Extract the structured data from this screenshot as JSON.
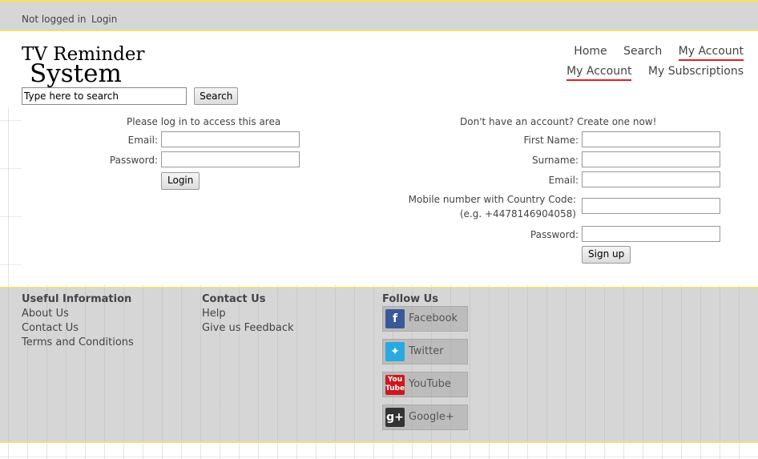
{
  "topbar": {
    "status": "Not logged in",
    "login_link": "Login"
  },
  "logo": {
    "line1": "TV Reminder",
    "line2": "System"
  },
  "search": {
    "placeholder": "Type here to search",
    "button": "Search"
  },
  "nav": {
    "primary": [
      "Home",
      "Search",
      "My Account"
    ],
    "secondary": [
      "My Account",
      "My Subscriptions"
    ]
  },
  "login": {
    "heading": "Please log in to access this area",
    "email_label": "Email:",
    "password_label": "Password:",
    "button": "Login"
  },
  "signup": {
    "heading": "Don't have an account? Create one now!",
    "first_name_label": "First Name:",
    "surname_label": "Surname:",
    "email_label": "Email:",
    "mobile_label_line1": "Mobile number with Country Code:",
    "mobile_label_line2": "(e.g. +4478146904058)",
    "password_label": "Password:",
    "button": "Sign up"
  },
  "footer": {
    "useful": {
      "heading": "Useful Information",
      "items": [
        "About Us",
        "Contact Us",
        "Terms and Conditions"
      ]
    },
    "contact": {
      "heading": "Contact Us",
      "items": [
        "Help",
        "Give us Feedback"
      ]
    },
    "follow": {
      "heading": "Follow Us",
      "items": [
        {
          "label": "Facebook",
          "icon": "facebook-icon",
          "color": "#3b5998"
        },
        {
          "label": "Twitter",
          "icon": "twitter-icon",
          "color": "#29a9e1"
        },
        {
          "label": "YouTube",
          "icon": "youtube-icon",
          "color": "#cc181e"
        },
        {
          "label": "Google+",
          "icon": "google-plus-icon",
          "color": "#333333"
        }
      ]
    }
  },
  "colors": {
    "accent_underline": "#e02020",
    "border_yellow": "#f2de7a",
    "bar_gray": "#d6d6d6"
  }
}
